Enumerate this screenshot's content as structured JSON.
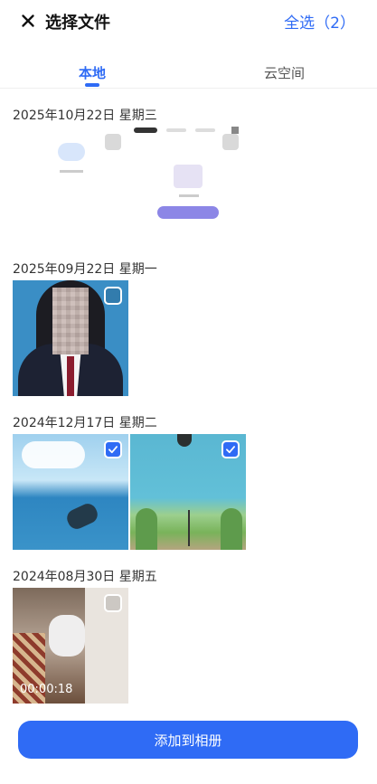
{
  "header": {
    "title": "选择文件",
    "select_all": "全选（2）"
  },
  "tabs": [
    {
      "label": "本地",
      "active": true
    },
    {
      "label": "云空间",
      "active": false
    }
  ],
  "groups": [
    {
      "date": "2025年10月22日  星期三",
      "items": [
        {
          "type": "screenshot",
          "selected": false
        }
      ]
    },
    {
      "date": "2025年09月22日  星期一",
      "items": [
        {
          "type": "photo",
          "selected": false
        }
      ]
    },
    {
      "date": "2024年12月17日  星期二",
      "items": [
        {
          "type": "photo",
          "selected": true
        },
        {
          "type": "photo",
          "selected": true
        }
      ]
    },
    {
      "date": "2024年08月30日  星期五",
      "items": [
        {
          "type": "video",
          "selected": false,
          "duration": "00:00:18"
        }
      ]
    }
  ],
  "bottom_button": {
    "label": "添加到相册"
  },
  "colors": {
    "accent": "#2f6bf5"
  }
}
